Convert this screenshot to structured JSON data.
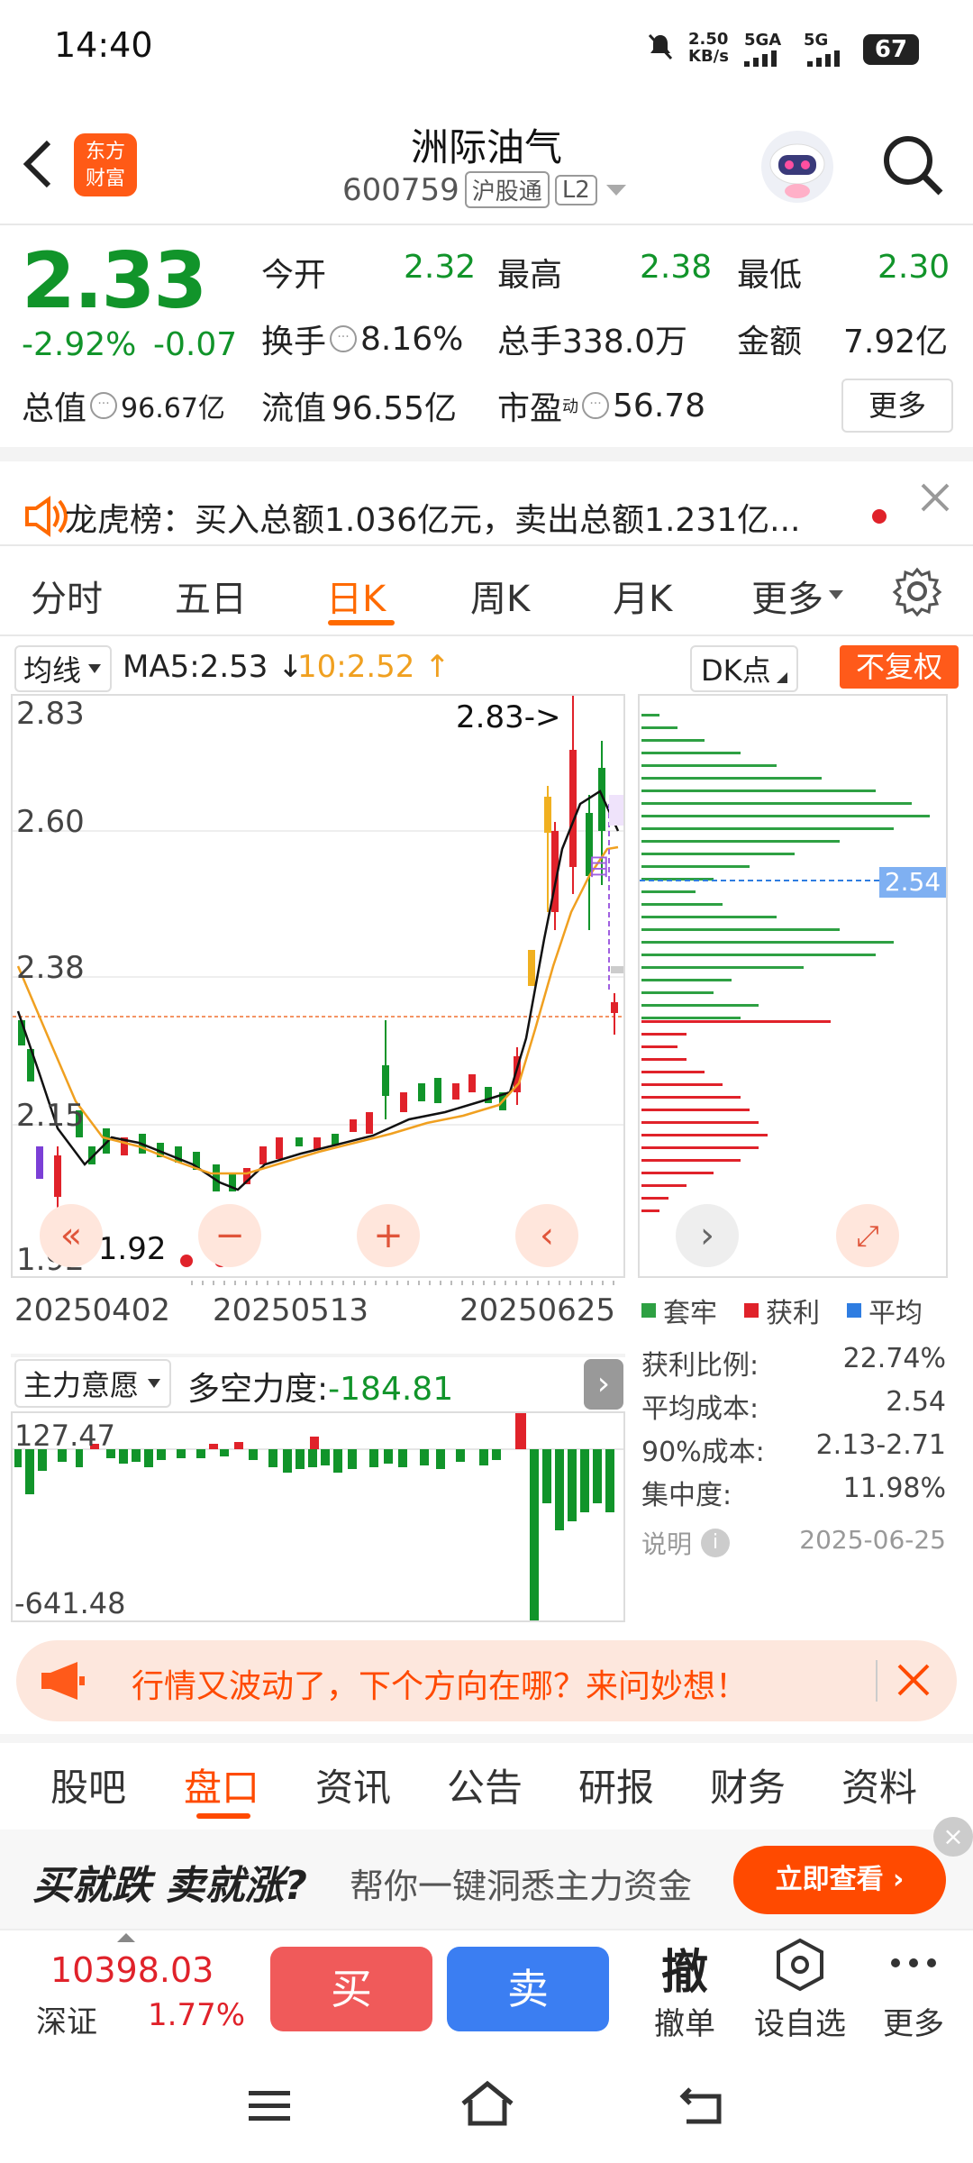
{
  "status_bar": {
    "time": "14:40",
    "speed": "2.50\nKB/s",
    "net1": "5GA",
    "net2": "5G",
    "battery": "67"
  },
  "header": {
    "title": "洲际油气",
    "code": "600759",
    "tag1": "沪股通",
    "tag2": "L2",
    "logo_line1": "东方",
    "logo_line2": "财富"
  },
  "quote": {
    "price": "2.33",
    "change_pct": "-2.92%",
    "change_abs": "-0.07",
    "open_label": "今开",
    "open": "2.32",
    "high_label": "最高",
    "high": "2.38",
    "low_label": "最低",
    "low": "2.30",
    "turnover_label": "换手",
    "turnover": "8.16%",
    "volume_label": "总手",
    "volume": "338.0万",
    "amount_label": "金额",
    "amount": "7.92亿",
    "mktcap_label": "总值",
    "mktcap": "96.67亿",
    "float_label": "流值",
    "float": "96.55亿",
    "pe_label": "市盈",
    "pe_sup": "动",
    "pe": "56.78",
    "more": "更多"
  },
  "notice": {
    "text": "龙虎榜：买入总额1.036亿元，卖出总额1.231亿..."
  },
  "tabs": [
    {
      "label": "分时"
    },
    {
      "label": "五日"
    },
    {
      "label": "日K"
    },
    {
      "label": "周K"
    },
    {
      "label": "月K"
    },
    {
      "label": "更多"
    }
  ],
  "kline": {
    "indicator": "均线",
    "ma5": "MA5:2.53",
    "ma10": "10:2.52",
    "dk": "DK点",
    "adjust": "不复权",
    "y_labels": [
      "2.83",
      "2.60",
      "2.38",
      "2.15",
      "1.92"
    ],
    "max_marker": "2.83->",
    "min_marker": "<-1.92",
    "target": "目",
    "dates": [
      "20250402",
      "20250513",
      "20250625"
    ],
    "sub_indicator": "主力意愿",
    "sub_label": "多空力度:",
    "sub_value": "-184.81",
    "sub_top": "127.47",
    "sub_bottom": "-641.48"
  },
  "chips": {
    "avg_tag": "2.54",
    "legend": [
      {
        "label": "套牢",
        "color": "#2ea043"
      },
      {
        "label": "获利",
        "color": "#e0222a"
      },
      {
        "label": "平均",
        "color": "#2f7de1"
      }
    ],
    "stats": [
      {
        "label": "获利比例:",
        "value": "22.74%"
      },
      {
        "label": "平均成本:",
        "value": "2.54"
      },
      {
        "label": "90%成本:",
        "value": "2.13-2.71"
      },
      {
        "label": "集中度:",
        "value": "11.98%"
      }
    ],
    "note": "说明",
    "date": "2025-06-25"
  },
  "banner": {
    "text": "行情又波动了，下个方向在哪？来问妙想！"
  },
  "bottom_tabs": [
    {
      "label": "股吧"
    },
    {
      "label": "盘口"
    },
    {
      "label": "资讯"
    },
    {
      "label": "公告"
    },
    {
      "label": "研报"
    },
    {
      "label": "财务"
    },
    {
      "label": "资料"
    }
  ],
  "ad": {
    "slogan": "买就跌 卖就涨?",
    "text": "帮你一键洞悉主力资金",
    "button": "立即查看"
  },
  "toolbar": {
    "index_value": "10398.03",
    "index_name": "深证",
    "index_change": "1.77%",
    "buy": "买",
    "sell": "卖",
    "cancel_icon": "撤",
    "cancel": "撤单",
    "watch": "设自选",
    "more": "更多"
  }
}
